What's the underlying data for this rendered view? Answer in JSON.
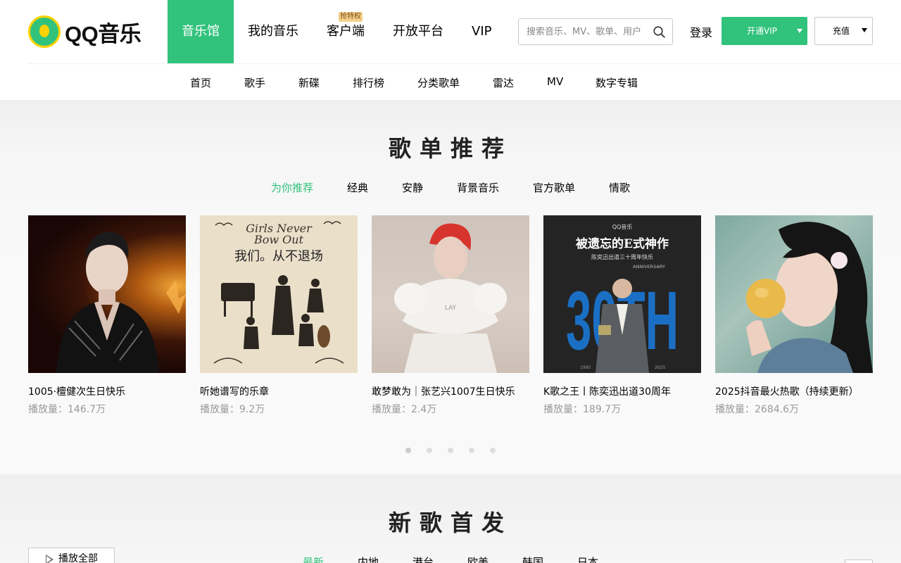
{
  "brand": {
    "logo_text": "QQ音乐"
  },
  "mainnav": {
    "items": [
      {
        "label": "音乐馆"
      },
      {
        "label": "我的音乐"
      },
      {
        "label": "客户端",
        "badge": "抢特权"
      },
      {
        "label": "开放平台"
      },
      {
        "label": "VIP"
      }
    ]
  },
  "search": {
    "placeholder": "搜索音乐、MV、歌单、用户"
  },
  "login": "登录",
  "vip_button": "开通VIP",
  "charge_button": "充值",
  "subnav": {
    "items": [
      "首页",
      "歌手",
      "新碟",
      "排行榜",
      "分类歌单",
      "雷达",
      "MV",
      "数字专辑"
    ]
  },
  "playlist_section": {
    "title": "歌单推荐",
    "tabs": [
      "为你推荐",
      "经典",
      "安静",
      "背景音乐",
      "官方歌单",
      "情歌"
    ],
    "active_tab": "为你推荐",
    "cards": [
      {
        "title": "1005·檀健次生日快乐",
        "plays": "播放量：146.7万"
      },
      {
        "title": "听她谱写的乐章",
        "plays": "播放量：9.2万",
        "cover_text": [
          "Girls Never",
          "Bow Out",
          "我们。从不退场"
        ]
      },
      {
        "title": "敢梦敢为｜张艺兴1007生日快乐",
        "plays": "播放量：2.4万",
        "cover_text": [
          "LAY"
        ]
      },
      {
        "title": "K歌之王丨陈奕迅出道30周年",
        "plays": "播放量：189.7万",
        "cover_text": [
          "QQ音乐",
          "被遗忘的E式神作",
          "陈奕迅出道三十周年快乐",
          "ANNIVERSARY",
          "30TH",
          "1995",
          "2025"
        ]
      },
      {
        "title": "2025抖音最火热歌（持续更新）",
        "plays": "播放量：2684.6万"
      }
    ],
    "carousel_pages": 5,
    "active_page": 1
  },
  "newsong_section": {
    "title": "新歌首发",
    "play_all": "播放全部",
    "tabs": [
      "最新",
      "内地",
      "港台",
      "欧美",
      "韩国",
      "日本"
    ],
    "active_tab": "最新"
  },
  "colors": {
    "accent": "#31c27c",
    "badge": "#f4d28c"
  }
}
